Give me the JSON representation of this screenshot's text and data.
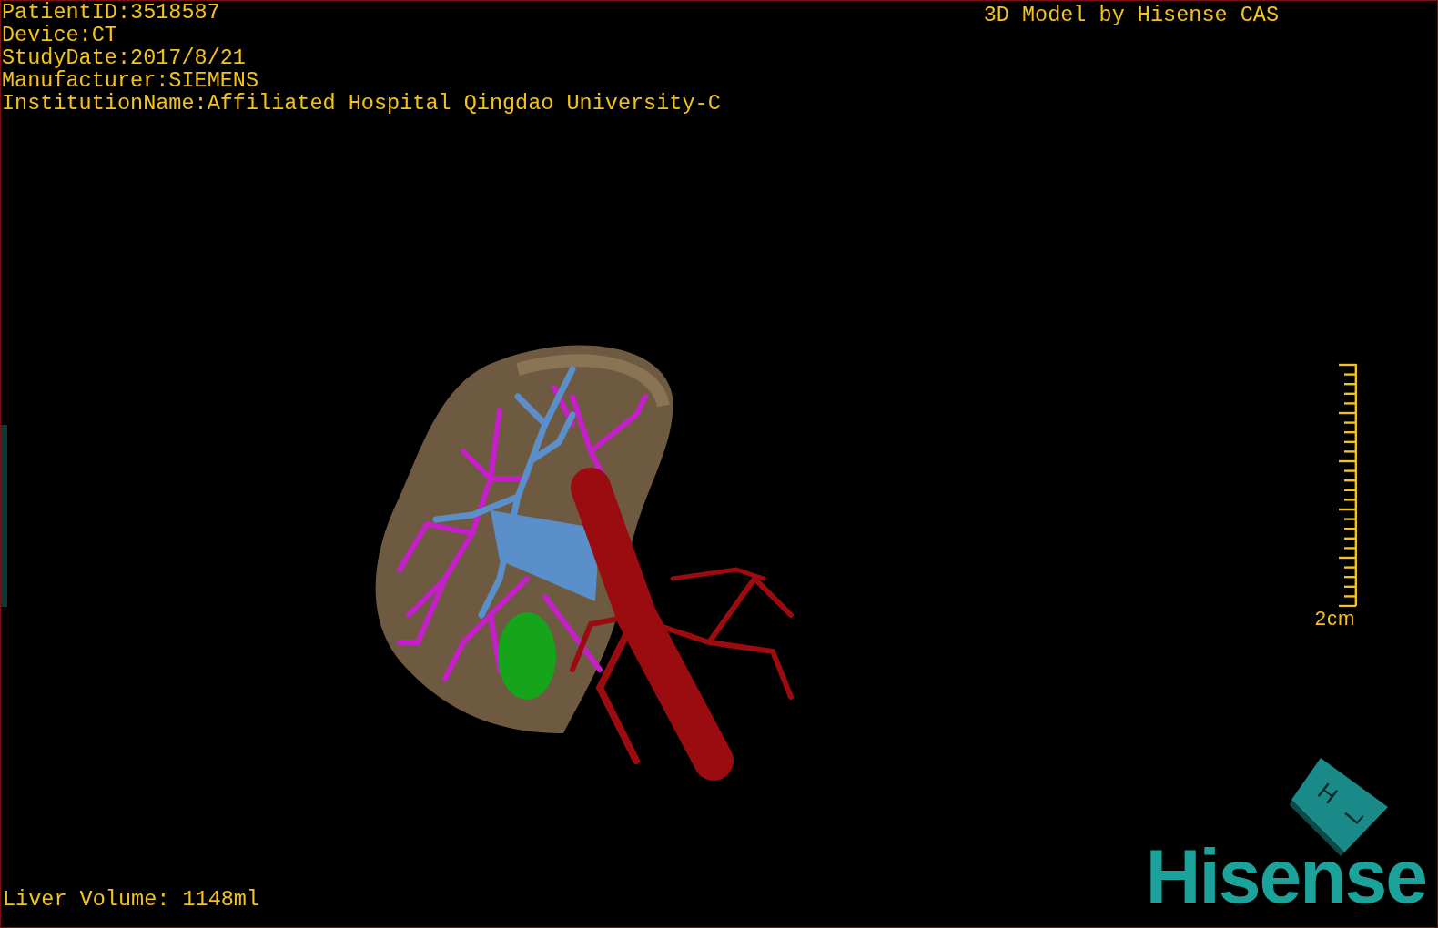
{
  "patient_info": [
    "PatientID:3518587",
    "Device:CT",
    "StudyDate:2017/8/21",
    "Manufacturer:SIEMENS",
    "InstitutionName:Affiliated Hospital Qingdao University-C"
  ],
  "model_title": "3D Model by Hisense CAS",
  "scale_bar": {
    "label": "2cm"
  },
  "orientation_cube": {
    "faces": [
      "H",
      "L"
    ]
  },
  "logo": "Hisense",
  "liver_volume": "Liver Volume: 1148ml"
}
